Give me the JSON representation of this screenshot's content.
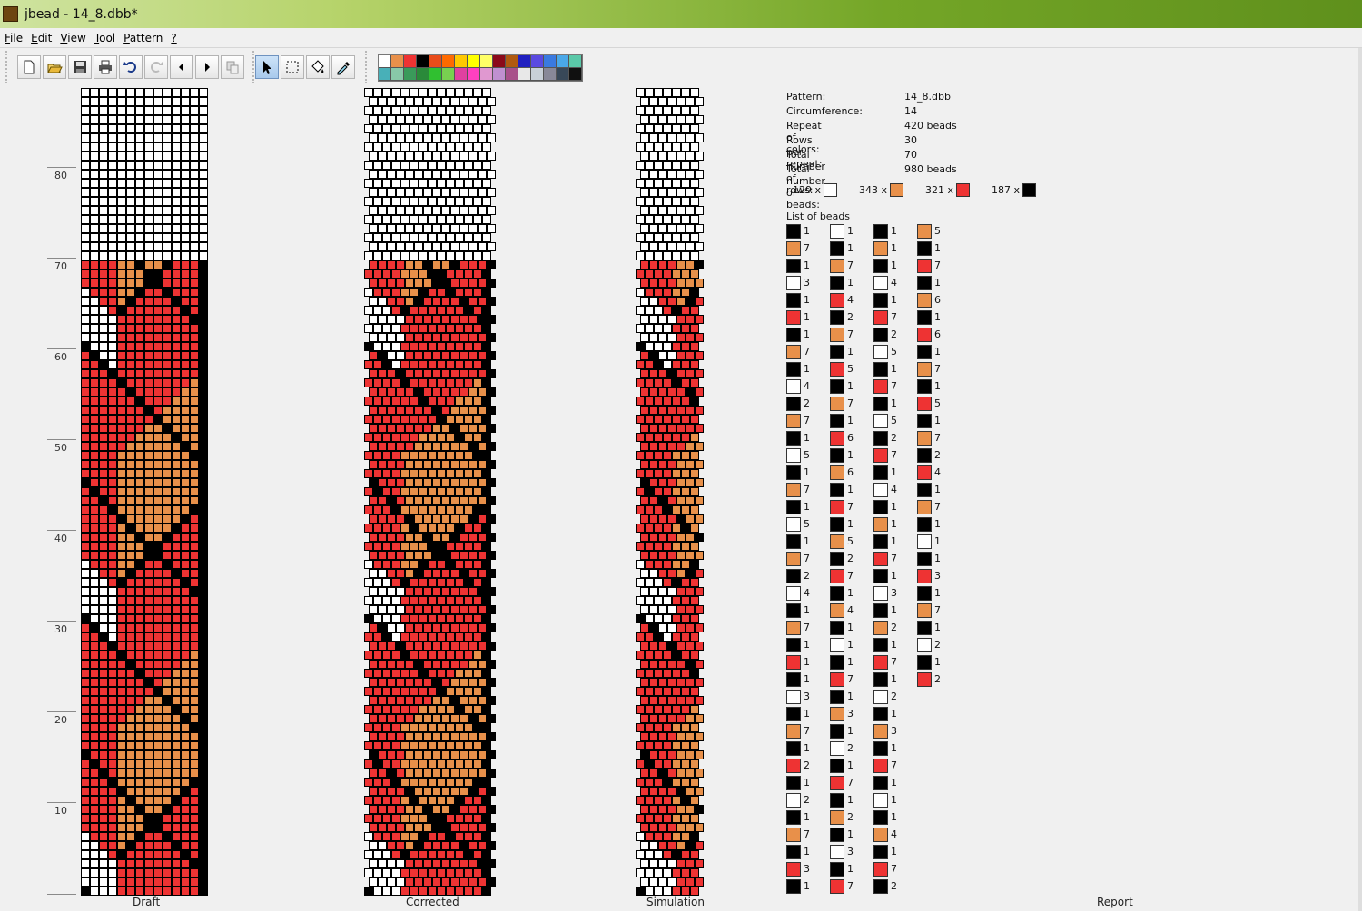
{
  "window": {
    "title": "jbead - 14_8.dbb*"
  },
  "menu": [
    {
      "label_ul": "F",
      "label_rest": "ile"
    },
    {
      "label_ul": "E",
      "label_rest": "dit"
    },
    {
      "label_ul": "V",
      "label_rest": "iew"
    },
    {
      "label_ul": "T",
      "label_rest": "ool"
    },
    {
      "label_ul": "P",
      "label_rest": "attern"
    },
    {
      "label_ul": "?",
      "label_rest": ""
    }
  ],
  "toolbar": {
    "buttons": [
      "new-icon",
      "open-icon",
      "save-icon",
      "print-icon",
      "undo-icon",
      "redo-icon",
      "arrow-left-icon",
      "arrow-right-icon",
      "copy-icon",
      "pointer-icon",
      "select-rect-icon",
      "fill-icon",
      "pipette-icon"
    ],
    "active_tool": "pointer-icon"
  },
  "palette": [
    "#ffffff",
    "#e8904a",
    "#ee3333",
    "#000000",
    "#e84c1a",
    "#ff6a00",
    "#ffc800",
    "#ffff00",
    "#ffff66",
    "#8b0a1a",
    "#b05a10",
    "#2020c0",
    "#5a4ae0",
    "#3a7ae0",
    "#4aa8e8",
    "#5ac8a8",
    "#48b0b8",
    "#88c8a8",
    "#3a9a5a",
    "#2a8a3a",
    "#30c030",
    "#78d050",
    "#e040a0",
    "#ff40c0",
    "#e098d0",
    "#c090d0",
    "#a8508a",
    "#e8e8e8",
    "#c8d0d8",
    "#888898",
    "#384858",
    "#101010"
  ],
  "colors": {
    "white": "#ffffff",
    "orange": "#e8904a",
    "red": "#ee3333",
    "black": "#000000"
  },
  "row_numbers": [
    "80",
    "70",
    "60",
    "50",
    "40",
    "30",
    "20",
    "10"
  ],
  "panels": {
    "draft": "Draft",
    "corrected": "Corrected",
    "simulation": "Simulation",
    "report": "Report"
  },
  "report": {
    "info": [
      {
        "key": "Pattern:",
        "value": "14_8.dbb"
      },
      {
        "key": "Circumference:",
        "value": "14"
      },
      {
        "key": "Repeat of colors:",
        "value": "420 beads"
      },
      {
        "key": "Rows per repeat:",
        "value": "30"
      },
      {
        "key": "Total number of rows:",
        "value": "70"
      },
      {
        "key": "Total number of beads:",
        "value": "980 beads"
      }
    ],
    "counts": [
      {
        "text": "129 x",
        "color": "white"
      },
      {
        "text": "343 x",
        "color": "orange"
      },
      {
        "text": "321 x",
        "color": "red"
      },
      {
        "text": "187 x",
        "color": "black"
      }
    ],
    "list_label": "List of beads",
    "bead_columns": [
      [
        [
          "black",
          "1"
        ],
        [
          "orange",
          "7"
        ],
        [
          "black",
          "1"
        ],
        [
          "white",
          "3"
        ],
        [
          "black",
          "1"
        ],
        [
          "red",
          "1"
        ],
        [
          "black",
          "1"
        ],
        [
          "orange",
          "7"
        ],
        [
          "black",
          "1"
        ],
        [
          "white",
          "4"
        ],
        [
          "black",
          "2"
        ],
        [
          "orange",
          "7"
        ],
        [
          "black",
          "1"
        ],
        [
          "white",
          "5"
        ],
        [
          "black",
          "1"
        ],
        [
          "orange",
          "7"
        ],
        [
          "black",
          "1"
        ],
        [
          "white",
          "5"
        ],
        [
          "black",
          "1"
        ],
        [
          "orange",
          "7"
        ],
        [
          "black",
          "2"
        ],
        [
          "white",
          "4"
        ],
        [
          "black",
          "1"
        ],
        [
          "orange",
          "7"
        ],
        [
          "black",
          "1"
        ],
        [
          "red",
          "1"
        ],
        [
          "black",
          "1"
        ],
        [
          "white",
          "3"
        ],
        [
          "black",
          "1"
        ],
        [
          "orange",
          "7"
        ],
        [
          "black",
          "1"
        ],
        [
          "red",
          "2"
        ],
        [
          "black",
          "1"
        ],
        [
          "white",
          "2"
        ],
        [
          "black",
          "1"
        ],
        [
          "orange",
          "7"
        ],
        [
          "black",
          "1"
        ],
        [
          "red",
          "3"
        ],
        [
          "black",
          "1"
        ]
      ],
      [
        [
          "white",
          "1"
        ],
        [
          "black",
          "1"
        ],
        [
          "orange",
          "7"
        ],
        [
          "black",
          "1"
        ],
        [
          "red",
          "4"
        ],
        [
          "black",
          "2"
        ],
        [
          "orange",
          "7"
        ],
        [
          "black",
          "1"
        ],
        [
          "red",
          "5"
        ],
        [
          "black",
          "1"
        ],
        [
          "orange",
          "7"
        ],
        [
          "black",
          "1"
        ],
        [
          "red",
          "6"
        ],
        [
          "black",
          "1"
        ],
        [
          "orange",
          "6"
        ],
        [
          "black",
          "1"
        ],
        [
          "red",
          "7"
        ],
        [
          "black",
          "1"
        ],
        [
          "orange",
          "5"
        ],
        [
          "black",
          "2"
        ],
        [
          "red",
          "7"
        ],
        [
          "black",
          "1"
        ],
        [
          "orange",
          "4"
        ],
        [
          "black",
          "1"
        ],
        [
          "white",
          "1"
        ],
        [
          "black",
          "1"
        ],
        [
          "red",
          "7"
        ],
        [
          "black",
          "1"
        ],
        [
          "orange",
          "3"
        ],
        [
          "black",
          "1"
        ],
        [
          "white",
          "2"
        ],
        [
          "black",
          "1"
        ],
        [
          "red",
          "7"
        ],
        [
          "black",
          "1"
        ],
        [
          "orange",
          "2"
        ],
        [
          "black",
          "1"
        ],
        [
          "white",
          "3"
        ],
        [
          "black",
          "1"
        ],
        [
          "red",
          "7"
        ]
      ],
      [
        [
          "black",
          "1"
        ],
        [
          "orange",
          "1"
        ],
        [
          "black",
          "1"
        ],
        [
          "white",
          "4"
        ],
        [
          "black",
          "1"
        ],
        [
          "red",
          "7"
        ],
        [
          "black",
          "2"
        ],
        [
          "white",
          "5"
        ],
        [
          "black",
          "1"
        ],
        [
          "red",
          "7"
        ],
        [
          "black",
          "1"
        ],
        [
          "white",
          "5"
        ],
        [
          "black",
          "2"
        ],
        [
          "red",
          "7"
        ],
        [
          "black",
          "1"
        ],
        [
          "white",
          "4"
        ],
        [
          "black",
          "1"
        ],
        [
          "orange",
          "1"
        ],
        [
          "black",
          "1"
        ],
        [
          "red",
          "7"
        ],
        [
          "black",
          "1"
        ],
        [
          "white",
          "3"
        ],
        [
          "black",
          "1"
        ],
        [
          "orange",
          "2"
        ],
        [
          "black",
          "1"
        ],
        [
          "red",
          "7"
        ],
        [
          "black",
          "1"
        ],
        [
          "white",
          "2"
        ],
        [
          "black",
          "1"
        ],
        [
          "orange",
          "3"
        ],
        [
          "black",
          "1"
        ],
        [
          "red",
          "7"
        ],
        [
          "black",
          "1"
        ],
        [
          "white",
          "1"
        ],
        [
          "black",
          "1"
        ],
        [
          "orange",
          "4"
        ],
        [
          "black",
          "1"
        ],
        [
          "red",
          "7"
        ],
        [
          "black",
          "2"
        ]
      ],
      [
        [
          "orange",
          "5"
        ],
        [
          "black",
          "1"
        ],
        [
          "red",
          "7"
        ],
        [
          "black",
          "1"
        ],
        [
          "orange",
          "6"
        ],
        [
          "black",
          "1"
        ],
        [
          "red",
          "6"
        ],
        [
          "black",
          "1"
        ],
        [
          "orange",
          "7"
        ],
        [
          "black",
          "1"
        ],
        [
          "red",
          "5"
        ],
        [
          "black",
          "1"
        ],
        [
          "orange",
          "7"
        ],
        [
          "black",
          "2"
        ],
        [
          "red",
          "4"
        ],
        [
          "black",
          "1"
        ],
        [
          "orange",
          "7"
        ],
        [
          "black",
          "1"
        ],
        [
          "white",
          "1"
        ],
        [
          "black",
          "1"
        ],
        [
          "red",
          "3"
        ],
        [
          "black",
          "1"
        ],
        [
          "orange",
          "7"
        ],
        [
          "black",
          "1"
        ],
        [
          "white",
          "2"
        ],
        [
          "black",
          "1"
        ],
        [
          "red",
          "2"
        ]
      ]
    ]
  }
}
